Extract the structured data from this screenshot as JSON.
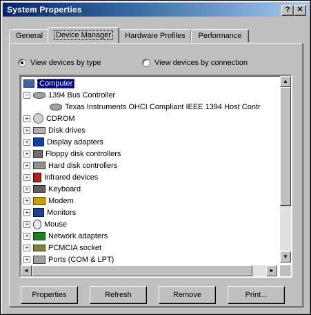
{
  "window": {
    "title": "System Properties",
    "help_glyph": "?",
    "close_glyph": "✕"
  },
  "tabs": [
    "General",
    "Device Manager",
    "Hardware Profiles",
    "Performance"
  ],
  "active_tab": "Device Manager",
  "view_options": {
    "by_type": "View devices by type",
    "by_connection": "View devices by connection",
    "selected": "by_type"
  },
  "tree": [
    {
      "label": "Computer",
      "icon": "computer-icon",
      "toggle": "",
      "selected": true,
      "level": 0
    },
    {
      "label": "1394 Bus Controller",
      "icon": "bus-controller-icon",
      "toggle": "−",
      "level": 1
    },
    {
      "label": "Texas Instruments OHCI Compliant IEEE 1394 Host Contr",
      "icon": "bus-controller-icon",
      "toggle": "",
      "level": 2
    },
    {
      "label": "CDROM",
      "icon": "cdrom-icon",
      "toggle": "+",
      "level": 1
    },
    {
      "label": "Disk drives",
      "icon": "disk-drive-icon",
      "toggle": "+",
      "level": 1
    },
    {
      "label": "Display adapters",
      "icon": "display-adapter-icon",
      "toggle": "+",
      "level": 1
    },
    {
      "label": "Floppy disk controllers",
      "icon": "floppy-controller-icon",
      "toggle": "+",
      "level": 1
    },
    {
      "label": "Hard disk controllers",
      "icon": "hard-disk-controller-icon",
      "toggle": "+",
      "level": 1
    },
    {
      "label": "Infrared devices",
      "icon": "infrared-icon",
      "toggle": "+",
      "level": 1
    },
    {
      "label": "Keyboard",
      "icon": "keyboard-icon",
      "toggle": "+",
      "level": 1
    },
    {
      "label": "Modem",
      "icon": "modem-icon",
      "toggle": "+",
      "level": 1
    },
    {
      "label": "Monitors",
      "icon": "monitor-icon",
      "toggle": "+",
      "level": 1
    },
    {
      "label": "Mouse",
      "icon": "mouse-icon",
      "toggle": "+",
      "level": 1
    },
    {
      "label": "Network adapters",
      "icon": "network-adapter-icon",
      "toggle": "+",
      "level": 1
    },
    {
      "label": "PCMCIA socket",
      "icon": "pcmcia-icon",
      "toggle": "+",
      "level": 1
    },
    {
      "label": "Ports (COM & LPT)",
      "icon": "ports-icon",
      "toggle": "+",
      "level": 1
    }
  ],
  "buttons": {
    "properties": "Properties",
    "refresh": "Refresh",
    "remove": "Remove",
    "print": "Print..."
  },
  "scroll": {
    "up": "▲",
    "down": "▼",
    "left": "◄",
    "right": "►"
  },
  "colors": {
    "title_active": "#0a246a",
    "selection": "#000080",
    "face": "#c0c0c0"
  }
}
